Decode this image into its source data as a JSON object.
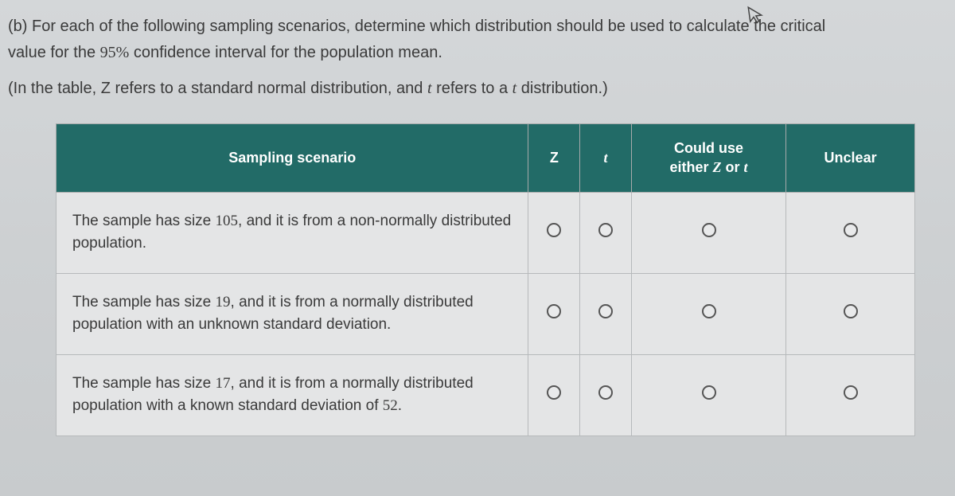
{
  "intro": {
    "line1_a": "(b) For each of the following sampling scenarios, determine which distribution should be used to calculate the critical",
    "line2_a": "value for the ",
    "line2_pct": "95%",
    "line2_b": " confidence interval for the population mean.",
    "line3_a": "(In the table, Z refers to a standard normal distribution, and ",
    "line3_t": "t",
    "line3_b": " refers to a ",
    "line3_t2": "t",
    "line3_c": " distribution.)"
  },
  "headers": {
    "scenario": "Sampling scenario",
    "z": "Z",
    "t": "t",
    "either_a": "Could use",
    "either_b": "either ",
    "either_z": "Z",
    "either_or": " or ",
    "either_t": "t",
    "unclear": "Unclear"
  },
  "rows": {
    "r1_a": "The sample has size ",
    "r1_n": "105",
    "r1_b": ", and it is from a non-normally distributed population.",
    "r2_a": "The sample has size ",
    "r2_n": "19",
    "r2_b": ", and it is from a normally distributed population with an unknown standard deviation.",
    "r3_a": "The sample has size ",
    "r3_n": "17",
    "r3_b": ", and it is from a normally distributed population with a known standard deviation of ",
    "r3_sd": "52",
    "r3_c": "."
  }
}
